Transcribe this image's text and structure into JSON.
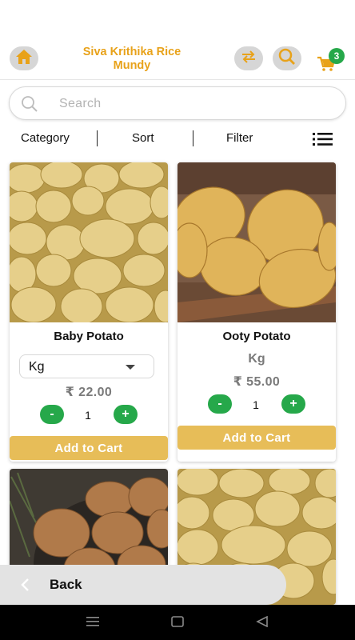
{
  "header": {
    "title_line1": "Siva Krithika Rice",
    "title_line2": "Mundy",
    "cart_count": "3",
    "accent_color": "#e8a21a",
    "icons": [
      "home-icon",
      "swap-icon",
      "search-icon",
      "cart-icon"
    ]
  },
  "search": {
    "placeholder": "Search"
  },
  "filters": {
    "category": "Category",
    "sort": "Sort",
    "filter": "Filter",
    "view_icon": "list-view-icon"
  },
  "products": [
    {
      "name": "Baby Potato",
      "unit": "Kg",
      "unit_type": "dropdown",
      "price": "₹ 22.00",
      "quantity": "1",
      "add_label": "Add to Cart"
    },
    {
      "name": "Ooty Potato",
      "unit": "Kg",
      "unit_type": "static",
      "price": "₹ 55.00",
      "quantity": "1",
      "add_label": "Add to Cart"
    },
    {
      "name": "",
      "image": "potato-basket"
    },
    {
      "name": "",
      "image": "potato-pile"
    }
  ],
  "qty_controls": {
    "minus": "-",
    "plus": "+"
  },
  "back": {
    "label": "Back"
  },
  "colors": {
    "green": "#26a84a",
    "add_button": "#e7bd58",
    "price_gray": "#7a7a7a"
  }
}
